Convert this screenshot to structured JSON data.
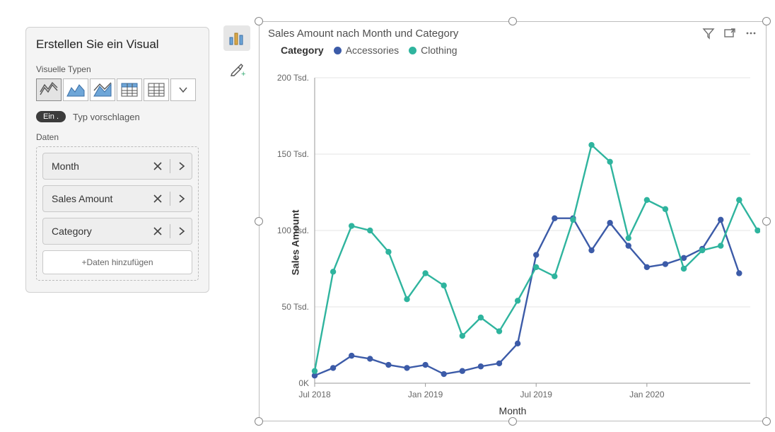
{
  "build_panel": {
    "title": "Erstellen Sie ein Visual",
    "visual_types_label": "Visuelle Typen",
    "suggest_toggle_label": "Ein .",
    "suggest_text": "Typ vorschlagen",
    "data_label": "Daten",
    "fields": [
      {
        "label": "Month"
      },
      {
        "label": "Sales Amount"
      },
      {
        "label": "Category"
      }
    ],
    "add_data_label": "+Daten hinzufügen"
  },
  "visual": {
    "title": "Sales Amount nach Month und Category",
    "legend_title": "Category",
    "ylabel": "Sales Amount",
    "xlabel": "Month"
  },
  "colors": {
    "accessories": "#3C5BA8",
    "clothing": "#2FB49E"
  },
  "chart_data": {
    "type": "line",
    "title": "Sales Amount nach Month und Category",
    "legend_title": "Category",
    "xlabel": "Month",
    "ylabel": "Sales Amount",
    "ylim": [
      0,
      200000
    ],
    "y_ticks": {
      "values": [
        0,
        50000,
        100000,
        150000,
        200000
      ],
      "labels": [
        "0K",
        "50 Tsd.",
        "100 Tsd.",
        "150 Tsd.",
        "200 Tsd."
      ]
    },
    "x_tick_labels": [
      "Jul 2018",
      "Jan 2019",
      "Jul 2019",
      "Jan 2020"
    ],
    "x_tick_indices": [
      0,
      6,
      12,
      18
    ],
    "x": [
      "Jul 2018",
      "Aug 2018",
      "Sep 2018",
      "Oct 2018",
      "Nov 2018",
      "Dec 2018",
      "Jan 2019",
      "Feb 2019",
      "Mar 2019",
      "Apr 2019",
      "May 2019",
      "Jun 2019",
      "Jul 2019",
      "Aug 2019",
      "Sep 2019",
      "Oct 2019",
      "Nov 2019",
      "Dec 2019",
      "Jan 2020",
      "Feb 2020",
      "Mar 2020",
      "Apr 2020",
      "May 2020",
      "Jun 2020"
    ],
    "series": [
      {
        "name": "Accessories",
        "color": "#3C5BA8",
        "values": [
          5000,
          10000,
          18000,
          16000,
          12000,
          10000,
          12000,
          6000,
          8000,
          11000,
          13000,
          26000,
          84000,
          108000,
          108000,
          87000,
          105000,
          90000,
          76000,
          78000,
          82000,
          88000,
          107000,
          72000
        ]
      },
      {
        "name": "Clothing",
        "color": "#2FB49E",
        "values": [
          8000,
          73000,
          103000,
          100000,
          86000,
          55000,
          72000,
          64000,
          31000,
          43000,
          34000,
          54000,
          76000,
          70000,
          107000,
          156000,
          145000,
          95000,
          120000,
          114000,
          75000,
          87000,
          90000,
          120000
        ]
      },
      {
        "name": "Clothing-tail",
        "color": "#2FB49E",
        "hidden_legend": true,
        "start_index": 23,
        "values": [
          120000,
          100000
        ]
      }
    ]
  }
}
